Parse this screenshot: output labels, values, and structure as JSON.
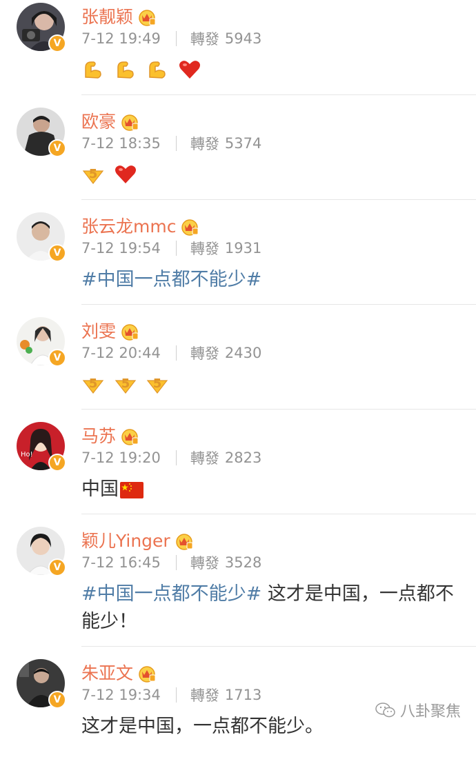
{
  "posts": [
    {
      "name": "张靓颖",
      "time": "7-12 19:49",
      "repost_label": "轉發",
      "repost_count": "5943",
      "content_emojis": [
        "muscle-emoji",
        "muscle-emoji",
        "muscle-emoji",
        "red-heart-emoji"
      ]
    },
    {
      "name": "欧豪",
      "time": "7-12 18:35",
      "repost_label": "轉發",
      "repost_count": "5374",
      "content_emojis": [
        "gold-5-emoji",
        "red-heart-emoji"
      ]
    },
    {
      "name": "张云龙mmc",
      "time": "7-12 19:54",
      "repost_label": "轉發",
      "repost_count": "1931",
      "hashtag": "#中国一点都不能少#"
    },
    {
      "name": "刘雯",
      "time": "7-12 20:44",
      "repost_label": "轉發",
      "repost_count": "2430",
      "content_emojis": [
        "gold-5-emoji",
        "gold-5-emoji",
        "gold-5-emoji"
      ]
    },
    {
      "name": "马苏",
      "time": "7-12 19:20",
      "repost_label": "轉發",
      "repost_count": "2823",
      "text": "中国",
      "content_emojis": [
        "china-flag-emoji"
      ]
    },
    {
      "name": "颖儿Yinger",
      "time": "7-12 16:45",
      "repost_label": "轉發",
      "repost_count": "3528",
      "hashtag": "#中国一点都不能少#",
      "text": " 这才是中国，一点都不能少！"
    },
    {
      "name": "朱亚文",
      "time": "7-12 19:34",
      "repost_label": "轉發",
      "repost_count": "1713",
      "text": "这才是中国，一点都不能少。"
    }
  ],
  "watermark": {
    "text": "八卦聚焦",
    "icon": "wechat-icon"
  },
  "colors": {
    "name": "#eb7350",
    "meta": "#939393",
    "hashtag": "#4f7ca6",
    "text": "#333333",
    "badge": "#f5a623"
  }
}
